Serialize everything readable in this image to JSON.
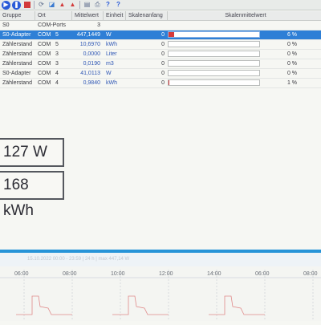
{
  "toolbar": {
    "buttons": [
      {
        "icon": "blue-circle-icon",
        "color": "#2a5bd8"
      },
      {
        "icon": "blue-circle-icon",
        "color": "#2a5bd8"
      },
      {
        "icon": "red-square-icon",
        "color": "#d23a3a"
      },
      {
        "icon": "refresh-icon",
        "color": "#5a6a8a"
      },
      {
        "icon": "chart-icon",
        "color": "#3a7ad0"
      },
      {
        "icon": "warning-triangle-icon",
        "color": "#d23a3a"
      },
      {
        "icon": "warning-triangle-icon",
        "color": "#d23a3a"
      },
      {
        "icon": "document-icon",
        "color": "#5a6a8a"
      },
      {
        "icon": "printer-icon",
        "color": "#5a6a8a"
      },
      {
        "icon": "help-icon",
        "color": "#2a5bd8"
      },
      {
        "icon": "help-pointer-icon",
        "color": "#2a5bd8"
      }
    ]
  },
  "table": {
    "headers": {
      "gruppe": "Gruppe",
      "ort": "Ort",
      "mittelwert": "Mittelwert",
      "einheit": "Einheit",
      "skalenanfang": "Skalenanfang",
      "skalenmittelwert": "Skalenmittelwert"
    },
    "group_row": {
      "gruppe": "S0",
      "ort": "COM-Ports",
      "mittelwert": "3"
    },
    "rows": [
      {
        "gruppe": "S0-Adapter",
        "ort": "COM",
        "port": "5",
        "mittelwert": "447,1449",
        "einheit": "W",
        "skalenanfang": "0",
        "fill": 0.06,
        "pct": "6 %",
        "selected": true
      },
      {
        "gruppe": "Zählerstand",
        "ort": "COM",
        "port": "5",
        "mittelwert": "10,6970",
        "einheit": "kWh",
        "skalenanfang": "0",
        "fill": 0,
        "pct": "0 %",
        "selected": false
      },
      {
        "gruppe": "Zählerstand",
        "ort": "COM",
        "port": "3",
        "mittelwert": "0,0000",
        "einheit": "Liter",
        "skalenanfang": "0",
        "fill": 0,
        "pct": "0 %",
        "selected": false
      },
      {
        "gruppe": "Zählerstand",
        "ort": "COM",
        "port": "3",
        "mittelwert": "0,0190",
        "einheit": "m3",
        "skalenanfang": "0",
        "fill": 0,
        "pct": "0 %",
        "selected": false
      },
      {
        "gruppe": "S0-Adapter",
        "ort": "COM",
        "port": "4",
        "mittelwert": "41,0113",
        "einheit": "W",
        "skalenanfang": "0",
        "fill": 0,
        "pct": "0 %",
        "selected": false
      },
      {
        "gruppe": "Zählerstand",
        "ort": "COM",
        "port": "4",
        "mittelwert": "0,9840",
        "einheit": "kWh",
        "skalenanfang": "0",
        "fill": 0.01,
        "pct": "1 %",
        "selected": false
      }
    ]
  },
  "readouts": {
    "power": "127 W",
    "energy": "168 kWh"
  },
  "infobar": {
    "text": "15.10.2022 00:00 - 23:59 | 24 h | max 447,14 W"
  },
  "timeline": {
    "labels": [
      "06:00",
      "08:00",
      "10:00",
      "12:00",
      "14:00",
      "06:00",
      "08:00"
    ]
  },
  "colors": {
    "accent": "#2794d8",
    "selected_row": "#2e7fd6",
    "bar_fill": "#d63a3a",
    "value_blue": "#2f57b5"
  }
}
